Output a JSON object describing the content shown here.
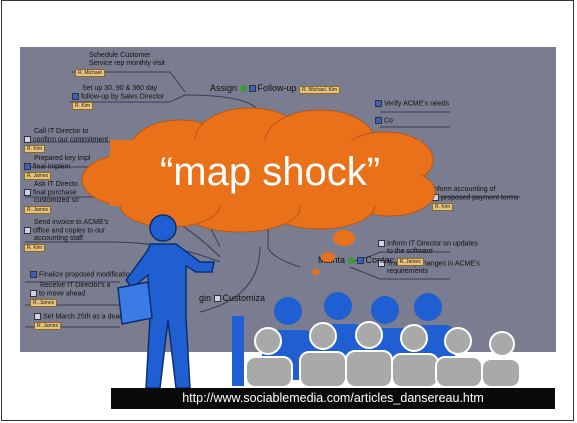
{
  "slide": {
    "title": "“map shock”",
    "url": "http://www.sociablemedia.com/articles_dansereau.htm"
  },
  "mindmap": {
    "nodes": [
      {
        "text": "Schedule Customer",
        "text2": "Service rep monthly visit",
        "tag": "R. Michael"
      },
      {
        "text": "Set up 30, 90 & 360 day",
        "text2": "follow-up by Sales Director",
        "tag": "R. Kim"
      },
      {
        "text": "Call IT Director to",
        "text2": "confirm our commitment",
        "tag": "R. Kim"
      },
      {
        "text": "Prepared key impl",
        "text2": "final implem",
        "tag": "R. James"
      },
      {
        "text": "Ask IT Directo",
        "text2": "final purchase",
        "text3": "customized so",
        "tag": "R. James"
      },
      {
        "text": "Send invoice to ACME's",
        "text2": "office and copies to our",
        "text3": "accounting staff",
        "tag": "R. Kim"
      },
      {
        "text": "Finalize proposed modificatio"
      },
      {
        "text": "Receive IT Director's a",
        "text2": "to move ahead",
        "tag": "R. James"
      },
      {
        "text": "Set March 25th as a deadl",
        "tag": "R. James"
      },
      {
        "text": "Verify ACME's needs"
      },
      {
        "text": "Co"
      },
      {
        "text": "Inform accounting of",
        "text2": "proposed payment terms",
        "tag": "R. Kim"
      },
      {
        "text": "Inform IT Director on updates",
        "text2": "to the software"
      },
      {
        "text": "Track any changes in ACME's",
        "text2": "requirements"
      }
    ],
    "hubs": [
      {
        "label": "Assign",
        "label2": "Follow-up",
        "tag": "R. Michael, Kim"
      },
      {
        "label": "Mainta",
        "label2": "Contac",
        "tag": "R. James"
      },
      {
        "label": "gin",
        "label2": "Customiza"
      }
    ]
  },
  "colors": {
    "cloud": "#e8711a",
    "presenter": "#1f5fd1",
    "audience_blue": "#1f5fd1",
    "audience_gray": "#a9a9a9",
    "map_bg": "#7a7d8f"
  }
}
